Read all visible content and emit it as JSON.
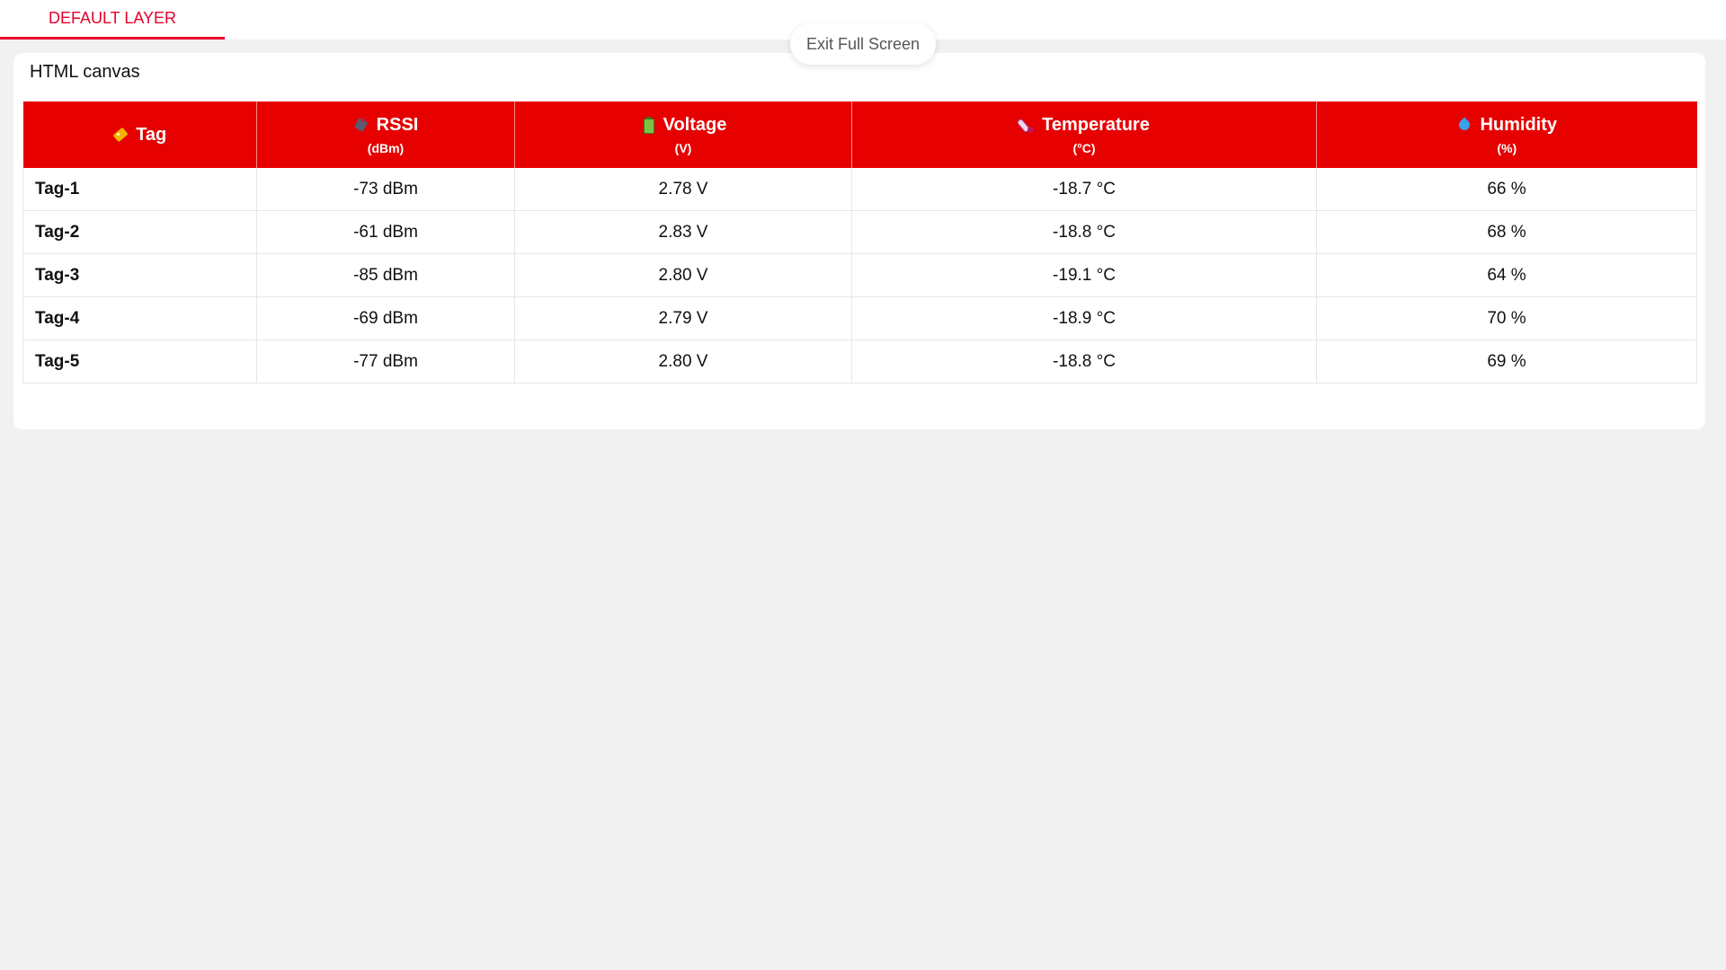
{
  "tabs": [
    {
      "label": "DEFAULT LAYER",
      "active": true
    }
  ],
  "exit_fullscreen_label": "Exit Full Screen",
  "card": {
    "title": "HTML canvas"
  },
  "table": {
    "header_color": "#e60000",
    "columns": [
      {
        "label": "Tag",
        "unit": "",
        "icon": "tag-icon"
      },
      {
        "label": "RSSI",
        "unit": "(dBm)",
        "icon": "antenna-icon"
      },
      {
        "label": "Voltage",
        "unit": "(V)",
        "icon": "battery-icon"
      },
      {
        "label": "Temperature",
        "unit": "(°C)",
        "icon": "thermometer-icon"
      },
      {
        "label": "Humidity",
        "unit": "(%)",
        "icon": "droplet-icon"
      }
    ],
    "rows": [
      {
        "tag": "Tag-1",
        "rssi": "-73 dBm",
        "voltage": "2.78 V",
        "temperature": "-18.7 °C",
        "humidity": "66 %"
      },
      {
        "tag": "Tag-2",
        "rssi": "-61 dBm",
        "voltage": "2.83 V",
        "temperature": "-18.8 °C",
        "humidity": "68 %"
      },
      {
        "tag": "Tag-3",
        "rssi": "-85 dBm",
        "voltage": "2.80 V",
        "temperature": "-19.1 °C",
        "humidity": "64 %"
      },
      {
        "tag": "Tag-4",
        "rssi": "-69 dBm",
        "voltage": "2.79 V",
        "temperature": "-18.9 °C",
        "humidity": "70 %"
      },
      {
        "tag": "Tag-5",
        "rssi": "-77 dBm",
        "voltage": "2.80 V",
        "temperature": "-18.8 °C",
        "humidity": "69 %"
      }
    ]
  },
  "colors": {
    "accent": "#e4002b",
    "background": "#f1f1f1"
  }
}
